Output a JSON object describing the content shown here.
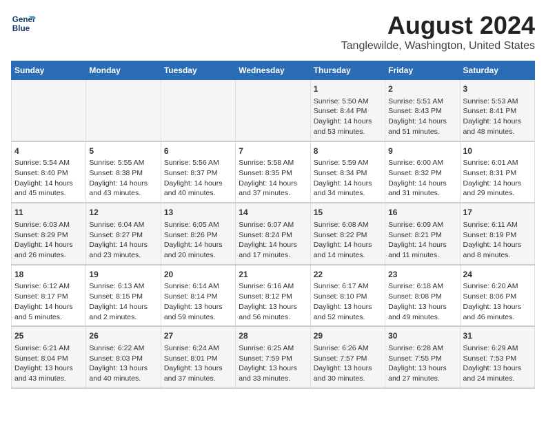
{
  "header": {
    "logo_line1": "General",
    "logo_line2": "Blue",
    "title": "August 2024",
    "subtitle": "Tanglewilde, Washington, United States"
  },
  "days_of_week": [
    "Sunday",
    "Monday",
    "Tuesday",
    "Wednesday",
    "Thursday",
    "Friday",
    "Saturday"
  ],
  "weeks": [
    [
      {
        "day": "",
        "content": ""
      },
      {
        "day": "",
        "content": ""
      },
      {
        "day": "",
        "content": ""
      },
      {
        "day": "",
        "content": ""
      },
      {
        "day": "1",
        "content": "Sunrise: 5:50 AM\nSunset: 8:44 PM\nDaylight: 14 hours\nand 53 minutes."
      },
      {
        "day": "2",
        "content": "Sunrise: 5:51 AM\nSunset: 8:43 PM\nDaylight: 14 hours\nand 51 minutes."
      },
      {
        "day": "3",
        "content": "Sunrise: 5:53 AM\nSunset: 8:41 PM\nDaylight: 14 hours\nand 48 minutes."
      }
    ],
    [
      {
        "day": "4",
        "content": "Sunrise: 5:54 AM\nSunset: 8:40 PM\nDaylight: 14 hours\nand 45 minutes."
      },
      {
        "day": "5",
        "content": "Sunrise: 5:55 AM\nSunset: 8:38 PM\nDaylight: 14 hours\nand 43 minutes."
      },
      {
        "day": "6",
        "content": "Sunrise: 5:56 AM\nSunset: 8:37 PM\nDaylight: 14 hours\nand 40 minutes."
      },
      {
        "day": "7",
        "content": "Sunrise: 5:58 AM\nSunset: 8:35 PM\nDaylight: 14 hours\nand 37 minutes."
      },
      {
        "day": "8",
        "content": "Sunrise: 5:59 AM\nSunset: 8:34 PM\nDaylight: 14 hours\nand 34 minutes."
      },
      {
        "day": "9",
        "content": "Sunrise: 6:00 AM\nSunset: 8:32 PM\nDaylight: 14 hours\nand 31 minutes."
      },
      {
        "day": "10",
        "content": "Sunrise: 6:01 AM\nSunset: 8:31 PM\nDaylight: 14 hours\nand 29 minutes."
      }
    ],
    [
      {
        "day": "11",
        "content": "Sunrise: 6:03 AM\nSunset: 8:29 PM\nDaylight: 14 hours\nand 26 minutes."
      },
      {
        "day": "12",
        "content": "Sunrise: 6:04 AM\nSunset: 8:27 PM\nDaylight: 14 hours\nand 23 minutes."
      },
      {
        "day": "13",
        "content": "Sunrise: 6:05 AM\nSunset: 8:26 PM\nDaylight: 14 hours\nand 20 minutes."
      },
      {
        "day": "14",
        "content": "Sunrise: 6:07 AM\nSunset: 8:24 PM\nDaylight: 14 hours\nand 17 minutes."
      },
      {
        "day": "15",
        "content": "Sunrise: 6:08 AM\nSunset: 8:22 PM\nDaylight: 14 hours\nand 14 minutes."
      },
      {
        "day": "16",
        "content": "Sunrise: 6:09 AM\nSunset: 8:21 PM\nDaylight: 14 hours\nand 11 minutes."
      },
      {
        "day": "17",
        "content": "Sunrise: 6:11 AM\nSunset: 8:19 PM\nDaylight: 14 hours\nand 8 minutes."
      }
    ],
    [
      {
        "day": "18",
        "content": "Sunrise: 6:12 AM\nSunset: 8:17 PM\nDaylight: 14 hours\nand 5 minutes."
      },
      {
        "day": "19",
        "content": "Sunrise: 6:13 AM\nSunset: 8:15 PM\nDaylight: 14 hours\nand 2 minutes."
      },
      {
        "day": "20",
        "content": "Sunrise: 6:14 AM\nSunset: 8:14 PM\nDaylight: 13 hours\nand 59 minutes."
      },
      {
        "day": "21",
        "content": "Sunrise: 6:16 AM\nSunset: 8:12 PM\nDaylight: 13 hours\nand 56 minutes."
      },
      {
        "day": "22",
        "content": "Sunrise: 6:17 AM\nSunset: 8:10 PM\nDaylight: 13 hours\nand 52 minutes."
      },
      {
        "day": "23",
        "content": "Sunrise: 6:18 AM\nSunset: 8:08 PM\nDaylight: 13 hours\nand 49 minutes."
      },
      {
        "day": "24",
        "content": "Sunrise: 6:20 AM\nSunset: 8:06 PM\nDaylight: 13 hours\nand 46 minutes."
      }
    ],
    [
      {
        "day": "25",
        "content": "Sunrise: 6:21 AM\nSunset: 8:04 PM\nDaylight: 13 hours\nand 43 minutes."
      },
      {
        "day": "26",
        "content": "Sunrise: 6:22 AM\nSunset: 8:03 PM\nDaylight: 13 hours\nand 40 minutes."
      },
      {
        "day": "27",
        "content": "Sunrise: 6:24 AM\nSunset: 8:01 PM\nDaylight: 13 hours\nand 37 minutes."
      },
      {
        "day": "28",
        "content": "Sunrise: 6:25 AM\nSunset: 7:59 PM\nDaylight: 13 hours\nand 33 minutes."
      },
      {
        "day": "29",
        "content": "Sunrise: 6:26 AM\nSunset: 7:57 PM\nDaylight: 13 hours\nand 30 minutes."
      },
      {
        "day": "30",
        "content": "Sunrise: 6:28 AM\nSunset: 7:55 PM\nDaylight: 13 hours\nand 27 minutes."
      },
      {
        "day": "31",
        "content": "Sunrise: 6:29 AM\nSunset: 7:53 PM\nDaylight: 13 hours\nand 24 minutes."
      }
    ]
  ]
}
